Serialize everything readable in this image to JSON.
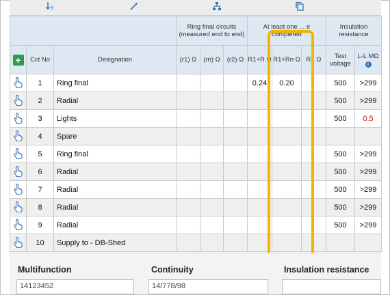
{
  "toolbar": {
    "icons": [
      "sort-icon",
      "magic-wand-icon",
      "hierarchy-icon",
      "copy-icon"
    ]
  },
  "headers": {
    "group_ring": "Ring final circuits (measured end to end)",
    "group_atleast": "At least one ... e completed",
    "group_insulation": "Insulation resistance",
    "cct_no": "Cct No",
    "designation": "Designation",
    "r1": "(r1) Ω",
    "rn": "(rn) Ω",
    "r2": "(r2) Ω",
    "r1r2": "R1+R Ω",
    "r1rn": "R1+Rn Ω",
    "r2col": "R2 Ω",
    "test_voltage": "Test voltage",
    "ll": "L-L MΩ"
  },
  "rows": [
    {
      "cct": "1",
      "designation": "Ring final",
      "r1r2": "0.24",
      "r1rn": "0.20",
      "tv": "500",
      "ll": ">299",
      "ll_red": false
    },
    {
      "cct": "2",
      "designation": "Radial",
      "r1r2": "",
      "r1rn": "",
      "tv": "500",
      "ll": ">299",
      "ll_red": false
    },
    {
      "cct": "3",
      "designation": "Lights",
      "r1r2": "",
      "r1rn": "",
      "tv": "500",
      "ll": "0.5",
      "ll_red": true
    },
    {
      "cct": "4",
      "designation": "Spare",
      "r1r2": "",
      "r1rn": "",
      "tv": "",
      "ll": "",
      "ll_red": false
    },
    {
      "cct": "5",
      "designation": "Ring final",
      "r1r2": "",
      "r1rn": "",
      "tv": "500",
      "ll": ">299",
      "ll_red": false
    },
    {
      "cct": "6",
      "designation": "Radial",
      "r1r2": "",
      "r1rn": "",
      "tv": "500",
      "ll": ">299",
      "ll_red": false
    },
    {
      "cct": "7",
      "designation": "Radial",
      "r1r2": "",
      "r1rn": "",
      "tv": "500",
      "ll": ">299",
      "ll_red": false
    },
    {
      "cct": "8",
      "designation": "Radial",
      "r1r2": "",
      "r1rn": "",
      "tv": "500",
      "ll": ">299",
      "ll_red": false
    },
    {
      "cct": "9",
      "designation": "Radial",
      "r1r2": "",
      "r1rn": "",
      "tv": "500",
      "ll": ">299",
      "ll_red": false
    },
    {
      "cct": "10",
      "designation": "Supply to - DB-Shed",
      "r1r2": "",
      "r1rn": "",
      "tv": "",
      "ll": "",
      "ll_red": false
    }
  ],
  "bottom": {
    "multifunction_label": "Multifunction",
    "multifunction_value": "14123452",
    "continuity_label": "Continuity",
    "continuity_value": "14/778/98",
    "insulation_label": "Insulation resistance"
  },
  "colors": {
    "highlight": "#f5b300",
    "header_bg": "#dde8f2",
    "fail_red": "#d01010",
    "add_green": "#2a9d46"
  }
}
